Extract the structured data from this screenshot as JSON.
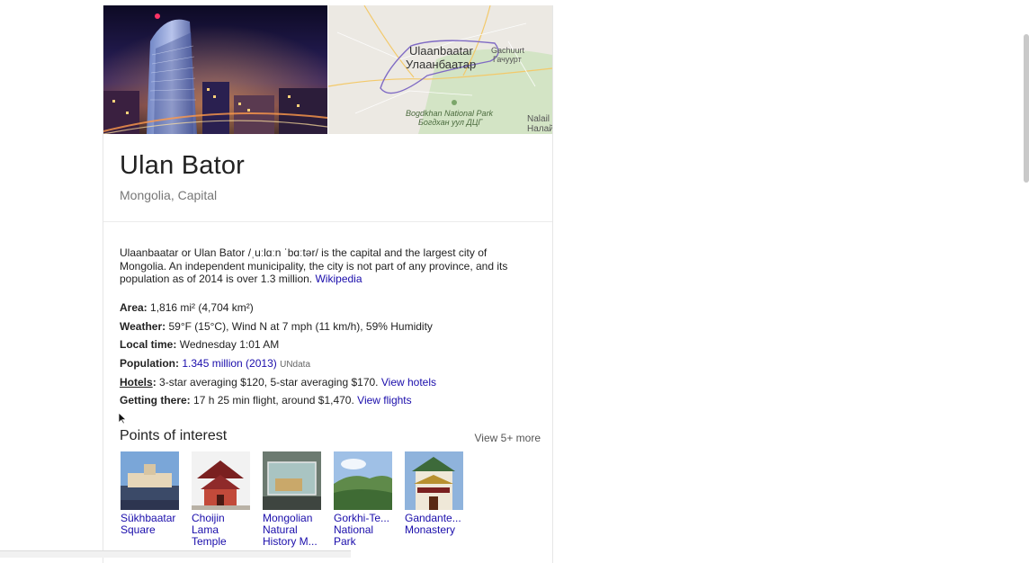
{
  "place": {
    "title": "Ulan Bator",
    "subtitle": "Mongolia, Capital"
  },
  "map": {
    "city_latin": "Ulaanbaatar",
    "city_cyrillic": "Улаанбаатар",
    "town_latin": "Gachuurt",
    "town_cyrillic": "Гачуурт",
    "park_latin": "Bogdkhan National Park",
    "park_cyrillic": "Богдхан уул ДЦГ",
    "edge_latin": "Nalail",
    "edge_cyrillic": "Налай"
  },
  "description": {
    "text": "Ulaanbaatar or Ulan Bator /ˌuːlɑːn ˈbɑːtər/ is the capital and the largest city of Mongolia. An independent municipality, the city is not part of any province, and its population as of 2014 is over 1.3 million.",
    "source_link": "Wikipedia"
  },
  "facts": {
    "area_label": "Area:",
    "area_value": "1,816 mi² (4,704 km²)",
    "weather_label": "Weather:",
    "weather_value": "59°F (15°C), Wind N at 7 mph (11 km/h), 59% Humidity",
    "local_time_label": "Local time:",
    "local_time_value": "Wednesday 1:01 AM",
    "population_label": "Population:",
    "population_value": "1.345 million (2013)",
    "population_source": "UNdata",
    "hotels_label": "Hotels",
    "hotels_value": "3-star averaging $120, 5-star averaging $170.",
    "hotels_link": "View hotels",
    "getting_there_label": "Getting there:",
    "getting_there_value": "17 h 25 min flight, around $1,470.",
    "getting_there_link": "View flights"
  },
  "points_of_interest": {
    "title": "Points of interest",
    "more_link": "View 5+ more",
    "items": [
      {
        "label": "Sükhbaatar Square"
      },
      {
        "label": "Choijin Lama Temple"
      },
      {
        "label": "Mongolian Natural History M..."
      },
      {
        "label": "Gorkhi-Te... National Park"
      },
      {
        "label": "Gandante... Monastery"
      }
    ]
  },
  "colors": {
    "link": "#1a0dab",
    "subtitle": "#777777",
    "body_text": "#222222"
  }
}
